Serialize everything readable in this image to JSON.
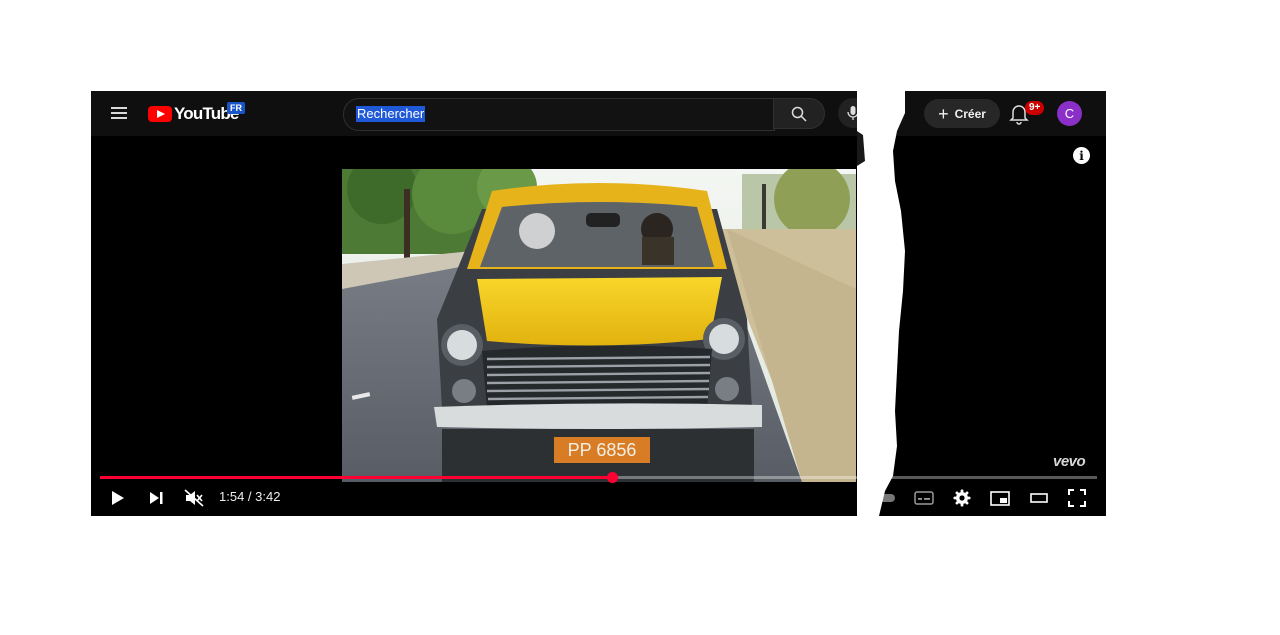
{
  "header": {
    "logo_text": "YouTube",
    "country_code": "FR",
    "search_placeholder": "Rechercher",
    "create_label": "Créer",
    "notification_count": "9+",
    "avatar_initial": "C"
  },
  "player": {
    "current_time": "1:54",
    "duration": "3:42",
    "time_display": "1:54 / 3:42",
    "progress_fraction": 0.514,
    "watermark": "vevo",
    "license_plate": "PP 6856"
  },
  "icons": [
    "menu-icon",
    "youtube-logo-icon",
    "search-icon",
    "mic-icon",
    "plus-icon",
    "bell-icon",
    "info-icon",
    "play-icon",
    "next-icon",
    "muted-volume-icon",
    "autoplay-toggle-icon",
    "subtitles-icon",
    "settings-gear-icon",
    "miniplayer-icon",
    "theater-mode-icon",
    "fullscreen-icon"
  ],
  "colors": {
    "accent": "#ff0033",
    "topbar": "#0f0f0f",
    "avatar": "#8a2fc8",
    "badge": "#cc0000"
  }
}
